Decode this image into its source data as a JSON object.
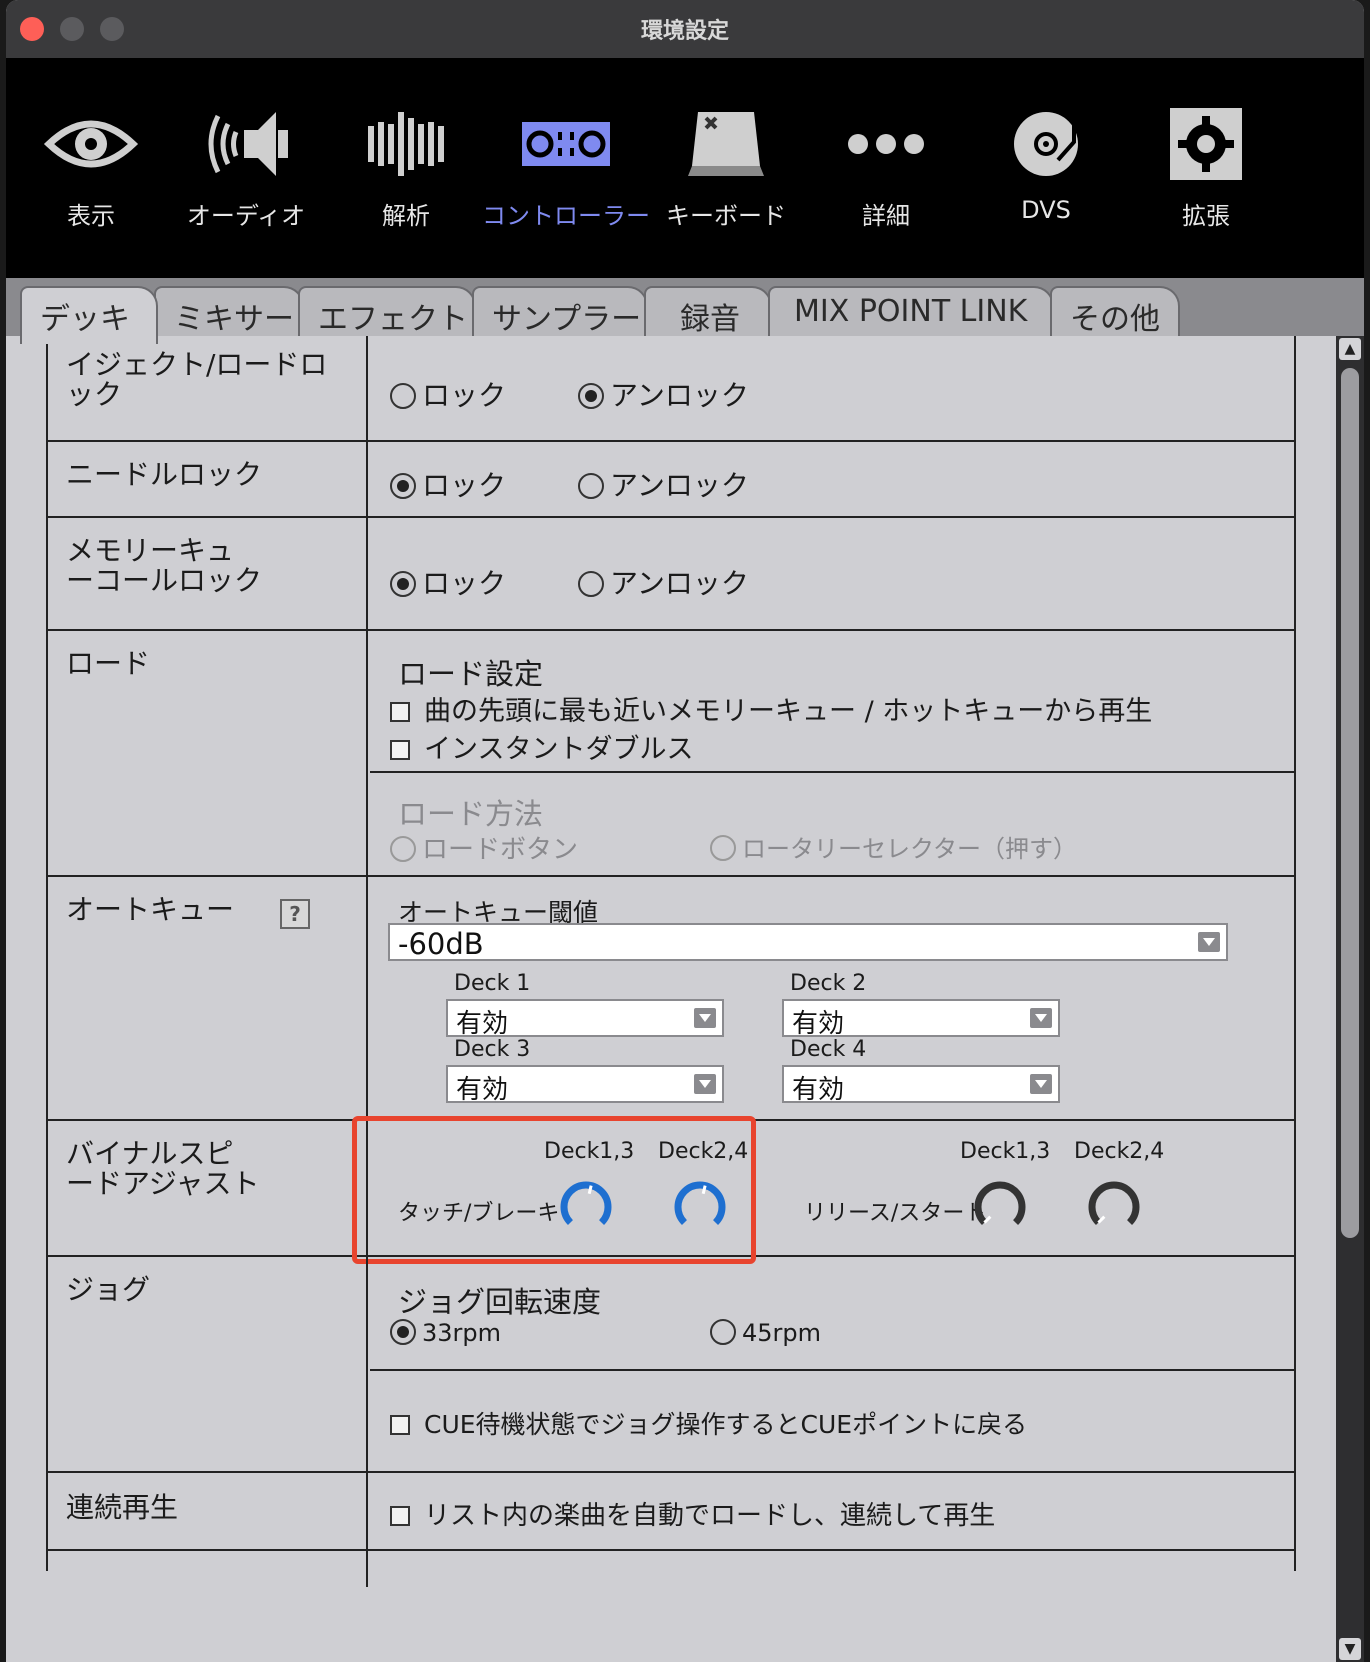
{
  "window": {
    "title": "環境設定"
  },
  "toolbar": {
    "items": [
      {
        "label": "表示",
        "icon": "eye-icon"
      },
      {
        "label": "オーディオ",
        "icon": "speaker-icon"
      },
      {
        "label": "解析",
        "icon": "waveform-bars-icon"
      },
      {
        "label": "コントローラー",
        "icon": "controller-icon",
        "active": true
      },
      {
        "label": "キーボード",
        "icon": "keyboard-key-icon"
      },
      {
        "label": "詳細",
        "icon": "more-dots-icon"
      },
      {
        "label": "DVS",
        "icon": "turntable-icon"
      },
      {
        "label": "拡張",
        "icon": "puzzle-gear-icon"
      }
    ],
    "active_color": "#7f8af0"
  },
  "tabs": [
    "デッキ",
    "ミキサー",
    "エフェクト",
    "サンプラー",
    "録音",
    "MIX POINT LINK",
    "その他"
  ],
  "settings": {
    "eject_lock": {
      "label": "イジェクト/ロードロック",
      "opt1": "ロック",
      "opt2": "アンロック",
      "selected": "アンロック"
    },
    "needle_lock": {
      "label": "ニードルロック",
      "opt1": "ロック",
      "opt2": "アンロック",
      "selected": "ロック"
    },
    "memory_cue_lock": {
      "label_line1": "メモリーキュ",
      "label_line2": "ーコールロック",
      "opt1": "ロック",
      "opt2": "アンロック",
      "selected": "ロック"
    },
    "load": {
      "label": "ロード",
      "setting_heading": "ロード設定",
      "check1": "曲の先頭に最も近いメモリーキュー / ホットキューから再生",
      "check2": "インスタントダブルス",
      "method_heading": "ロード方法",
      "method_opt1": "ロードボタン",
      "method_opt2": "ロータリーセレクター（押す）"
    },
    "auto_cue": {
      "label": "オートキュー",
      "help": "?",
      "threshold_label": "オートキュー閾値",
      "threshold_value": "-60dB",
      "deck1_label": "Deck 1",
      "deck1_value": "有効",
      "deck2_label": "Deck 2",
      "deck2_value": "有効",
      "deck3_label": "Deck 3",
      "deck3_value": "有効",
      "deck4_label": "Deck 4",
      "deck4_value": "有効"
    },
    "vinyl_speed": {
      "label_line1": "バイナルスピ",
      "label_line2": "ードアジャスト",
      "touch_brake_label": "タッチ/ブレーキ",
      "release_start_label": "リリース/スタート",
      "deck13": "Deck1,3",
      "deck24": "Deck2,4",
      "touch_brake_deck13_level": 0.55,
      "touch_brake_deck24_level": 0.55,
      "release_start_deck13_level": 0,
      "release_start_deck24_level": 0,
      "knob_active_color": "#1e6fd0",
      "highlight_color": "#e8442e"
    },
    "jog": {
      "label": "ジョグ",
      "speed_heading": "ジョグ回転速度",
      "opt1": "33rpm",
      "opt2": "45rpm",
      "selected": "33rpm",
      "cue_check": "CUE待機状態でジョグ操作するとCUEポイントに戻る"
    },
    "continuous": {
      "label": "連続再生",
      "check": "リスト内の楽曲を自動でロードし、連続して再生"
    }
  }
}
